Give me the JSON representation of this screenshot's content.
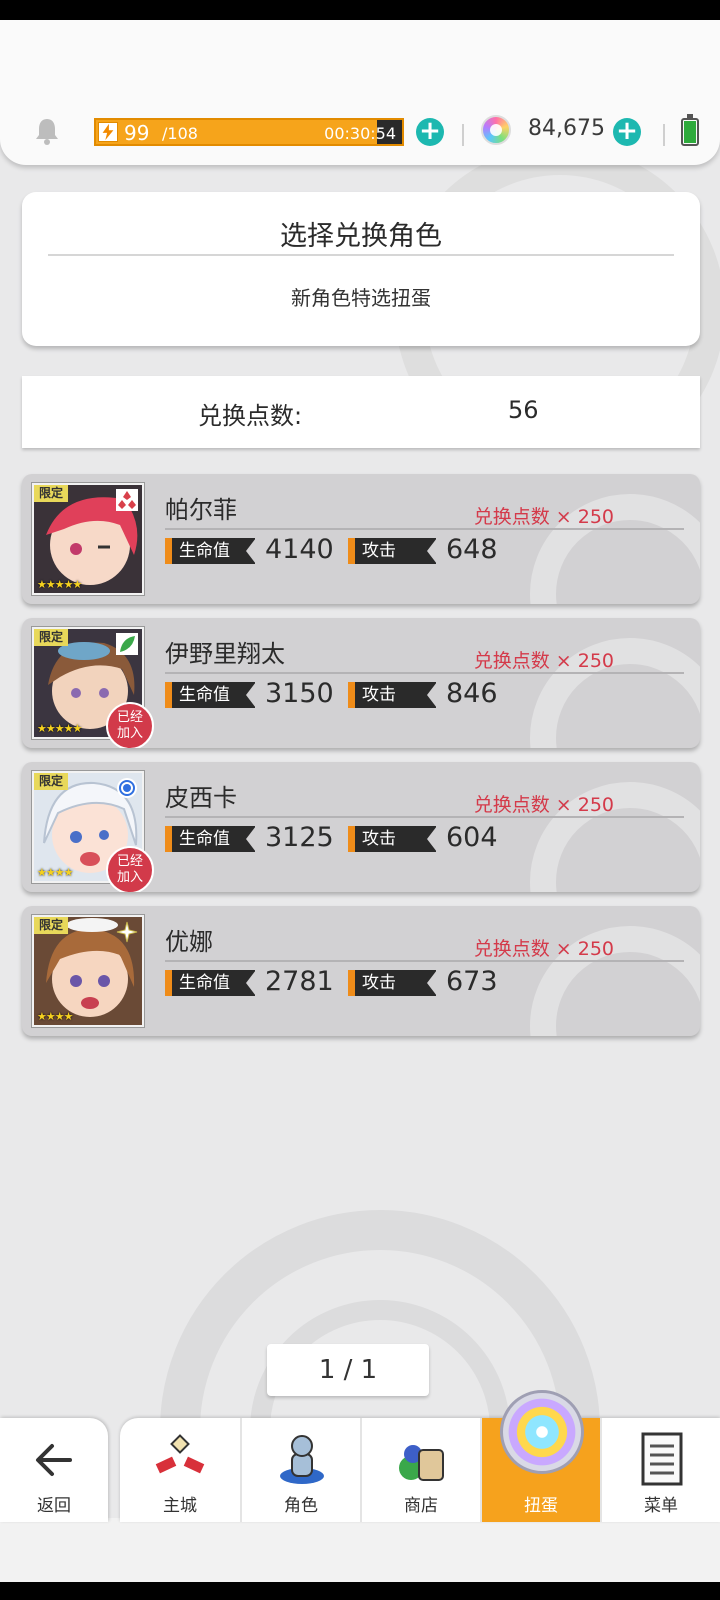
{
  "header": {
    "stamina_current": "99",
    "stamina_max": "/108",
    "stamina_timer": "00:30:54",
    "stamina_fraction": 0.9167,
    "gem_count": "84,675"
  },
  "panel": {
    "title": "选择兑换角色",
    "subtitle": "新角色特选扭蛋"
  },
  "points": {
    "label": "兑换点数:",
    "value": "56"
  },
  "labels": {
    "limited": "限定",
    "joined": "已经\n加入",
    "hp": "生命值",
    "atk": "攻击"
  },
  "characters": [
    {
      "name": "帕尔菲",
      "cost": "兑换点数 × 250",
      "hp": "4140",
      "atk": "648",
      "stars": "★★★★★",
      "joined": false,
      "attribute_icon": "triple-diamond-icon",
      "attribute_color": "#d8404a"
    },
    {
      "name": "伊野里翔太",
      "cost": "兑换点数 × 250",
      "hp": "3150",
      "atk": "846",
      "stars": "★★★★★",
      "joined": true,
      "attribute_icon": "leaf-icon",
      "attribute_color": "#3aa84a"
    },
    {
      "name": "皮西卡",
      "cost": "兑换点数 × 250",
      "hp": "3125",
      "atk": "604",
      "stars": "★★★★",
      "joined": true,
      "attribute_icon": "ring-icon",
      "attribute_color": "#2f6fe0"
    },
    {
      "name": "优娜",
      "cost": "兑换点数 × 250",
      "hp": "2781",
      "atk": "673",
      "stars": "★★★★",
      "joined": false,
      "attribute_icon": "sparkle-icon",
      "attribute_color": "#e8d85a"
    }
  ],
  "pager": {
    "text": "1 / 1"
  },
  "nav": {
    "back_label": "返回",
    "tabs": [
      {
        "label": "主城",
        "icon": "castle-icon"
      },
      {
        "label": "角色",
        "icon": "character-icon"
      },
      {
        "label": "商店",
        "icon": "shop-bag-icon"
      },
      {
        "label": "扭蛋",
        "icon": "gacha-orb-icon"
      },
      {
        "label": "菜单",
        "icon": "menu-list-icon"
      }
    ],
    "active_tab": "扭蛋"
  },
  "colors": {
    "accent_orange": "#f6a21d",
    "plus_teal": "#1db8b0",
    "cost_red": "#d43a4a"
  }
}
